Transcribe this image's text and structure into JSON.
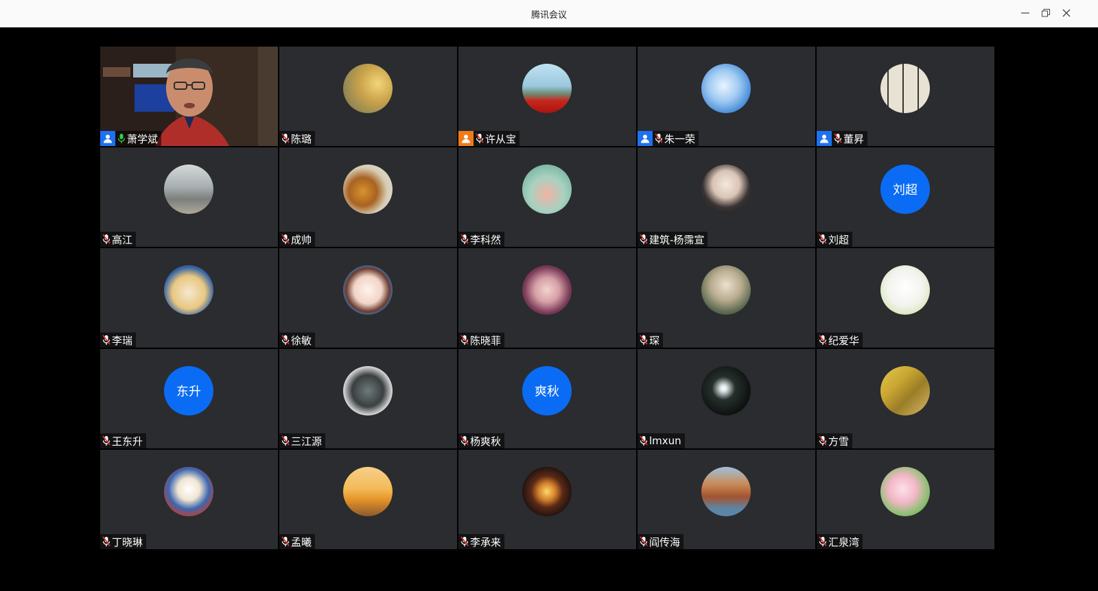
{
  "window": {
    "title": "腾讯会议"
  },
  "participants": [
    {
      "name": "萧学斌",
      "video": true,
      "host": "blue",
      "mic": "on"
    },
    {
      "name": "陈璐",
      "avatar": "photo-sunlight"
    },
    {
      "name": "许从宝",
      "host": "orange",
      "avatar": "photo-city-banner"
    },
    {
      "name": "朱一荣",
      "host": "blue",
      "avatar": "photo-iceberg"
    },
    {
      "name": "董昇",
      "host": "blue",
      "avatar": "photo-calligraphy"
    },
    {
      "name": "高江",
      "avatar": "photo-road"
    },
    {
      "name": "成帅",
      "avatar": "photo-tiger"
    },
    {
      "name": "李科然",
      "avatar": "photo-lotus"
    },
    {
      "name": "建筑-杨霈宣",
      "avatar": "photo-man-glasses"
    },
    {
      "name": "刘超",
      "avatarText": "刘超"
    },
    {
      "name": "李瑞",
      "avatar": "photo-cartoon-hat"
    },
    {
      "name": "徐敏",
      "avatar": "photo-cartoon-girl"
    },
    {
      "name": "陈晓菲",
      "avatar": "photo-woman-portrait"
    },
    {
      "name": "琛",
      "avatar": "photo-man-portrait"
    },
    {
      "name": "纪爱华",
      "avatar": "photo-sheep-drawing"
    },
    {
      "name": "王东升",
      "avatarText": "东升"
    },
    {
      "name": "三江源",
      "avatar": "photo-fisheye-street"
    },
    {
      "name": "杨爽秋",
      "avatarText": "爽秋"
    },
    {
      "name": "lmxun",
      "avatar": "photo-dark-figure"
    },
    {
      "name": "方雪",
      "avatar": "photo-golden-painting"
    },
    {
      "name": "丁晓琳",
      "avatar": "photo-donald-duck"
    },
    {
      "name": "孟曦",
      "avatar": "photo-sunset"
    },
    {
      "name": "李承来",
      "avatar": "photo-stained-glass"
    },
    {
      "name": "阎传海",
      "avatar": "photo-coast-rocks"
    },
    {
      "name": "汇泉湾",
      "avatar": "photo-blossoms"
    }
  ]
}
